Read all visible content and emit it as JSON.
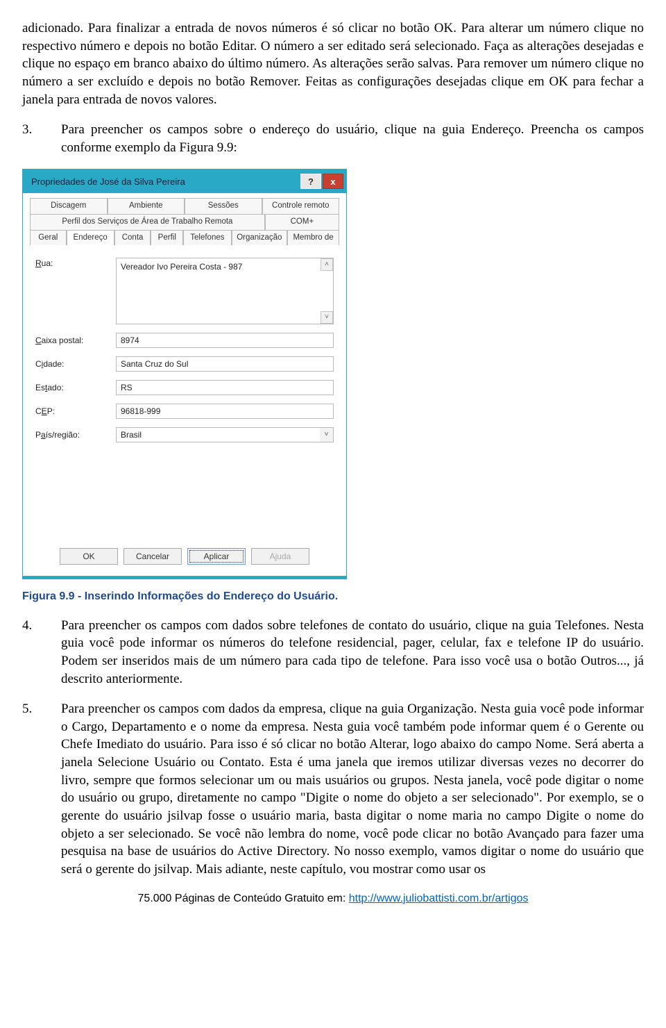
{
  "paragraphs": {
    "p1": "adicionado. Para finalizar a entrada de novos números é só clicar no botão OK. Para alterar um número clique no respectivo número e depois no botão Editar. O número a ser editado será selecionado. Faça as alterações desejadas e clique no espaço em branco abaixo do último número. As alterações serão salvas. Para remover um número clique no número a ser excluído e depois no botão Remover. Feitas as configurações desejadas clique em OK para fechar a janela para entrada de novos valores.",
    "item3_num": "3.",
    "item3_body": "Para preencher os campos sobre o endereço do usuário, clique na guia Endereço. Preencha os campos conforme exemplo da Figura 9.9:",
    "item4_num": "4.",
    "item4_body": "Para preencher os campos com dados sobre telefones de contato do usuário, clique na guia Telefones. Nesta guia você pode informar os números do telefone residencial, pager, celular, fax e telefone IP do usuário. Podem ser inseridos mais de um número para cada tipo de telefone. Para isso você usa o botão Outros..., já descrito anteriormente.",
    "item5_num": "5.",
    "item5_body": "Para preencher os campos com dados da empresa, clique na guia Organização. Nesta guia você pode informar o Cargo, Departamento e o nome da empresa. Nesta guia você também pode informar quem é o Gerente ou Chefe Imediato do usuário. Para isso é só clicar no botão Alterar, logo abaixo do campo Nome. Será aberta a janela Selecione Usuário ou Contato. Esta é uma janela que iremos utilizar diversas vezes no decorrer do livro, sempre que formos selecionar um ou mais usuários ou grupos. Nesta janela, você pode digitar o nome do usuário ou grupo, diretamente no campo \"Digite o nome do objeto a ser selecionado\". Por exemplo, se o gerente do usuário jsilvap fosse o usuário maria, basta digitar o nome maria no campo Digite o nome do objeto a ser selecionado. Se você não lembra do nome, você pode clicar no botão Avançado para fazer uma pesquisa na base de usuários do Active Directory. No nosso exemplo, vamos digitar o nome do usuário que será o gerente do jsilvap. Mais adiante, neste capítulo, vou mostrar como usar os"
  },
  "figure_caption": "Figura 9.9 - Inserindo Informações do Endereço do Usuário.",
  "dialog": {
    "title": "Propriedades de José da Silva Pereira",
    "help_symbol": "?",
    "close_symbol": "x",
    "tabs_row1": [
      "Discagem",
      "Ambiente",
      "Sessões",
      "Controle remoto"
    ],
    "tabs_row2": [
      "Perfil dos Serviços de Área de Trabalho Remota",
      "COM+"
    ],
    "tabs_row3": [
      "Geral",
      "Endereço",
      "Conta",
      "Perfil",
      "Telefones",
      "Organização",
      "Membro de"
    ],
    "active_tab": "Endereço",
    "fields": {
      "rua": {
        "label_pre": "R",
        "label_rest": "ua:",
        "value": "Vereador Ivo Pereira Costa - 987"
      },
      "caixa": {
        "label_pre": "",
        "label_u": "C",
        "label_rest": "aixa postal:",
        "value": "8974"
      },
      "cidade": {
        "label_pre": "C",
        "label_u": "i",
        "label_rest": "dade:",
        "value": "Santa Cruz do Sul"
      },
      "estado": {
        "label_pre": "Es",
        "label_u": "t",
        "label_rest": "ado:",
        "value": "RS"
      },
      "cep": {
        "label_pre": "C",
        "label_u": "E",
        "label_rest": "P:",
        "value": "96818-999"
      },
      "pais": {
        "label_pre": "P",
        "label_u": "a",
        "label_rest": "ís/região:",
        "value": "Brasil"
      }
    },
    "buttons": {
      "ok": "OK",
      "cancel": "Cancelar",
      "apply": "Aplicar",
      "help": "Ajuda"
    }
  },
  "footer": {
    "text_before": "75.000 Páginas de Conteúdo Gratuito em: ",
    "link_text": "http://www.juliobattisti.com.br/artigos"
  }
}
